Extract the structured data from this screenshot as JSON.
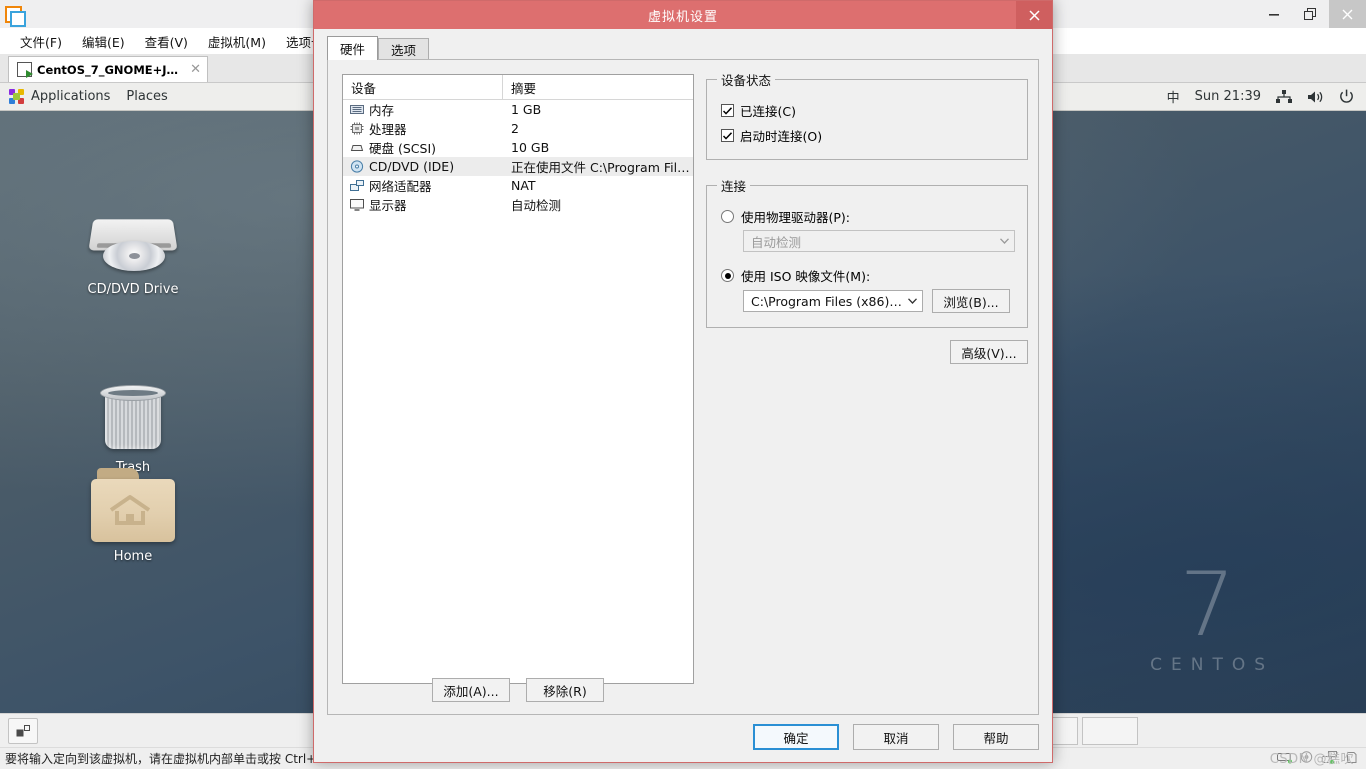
{
  "host": {
    "window_controls": {
      "minimize": "—",
      "restore": "❐",
      "close": "✕"
    },
    "menus": [
      "文件(F)",
      "编辑(E)",
      "查看(V)",
      "虚拟机(M)",
      "选项卡(T)"
    ],
    "tab": {
      "label": "CentOS_7_GNOME+Java+...",
      "close": "✕"
    },
    "statusbar": {
      "text": "要将输入定向到该虚拟机，请在虚拟机内部单击或按 Ctrl+"
    },
    "watermark": "CSDN @糕吹"
  },
  "guest": {
    "topbar": {
      "applications": "Applications",
      "places": "Places",
      "input_method": "中",
      "clock": "Sun 21:39"
    },
    "desktop_icons": [
      {
        "label": "CD/DVD Drive",
        "icon": "cd-drive-icon"
      },
      {
        "label": "Trash",
        "icon": "trash-icon"
      },
      {
        "label": "Home",
        "icon": "home-folder-icon"
      }
    ],
    "wallpaper_watermark": {
      "number": "7",
      "word": "CENTOS"
    }
  },
  "dialog": {
    "title": "虚拟机设置",
    "close_label": "✕",
    "tabs": [
      {
        "label": "硬件",
        "active": true
      },
      {
        "label": "选项",
        "active": false
      }
    ],
    "device_table": {
      "headers": [
        "设备",
        "摘要"
      ],
      "rows": [
        {
          "name": "内存",
          "summary": "1 GB",
          "icon": "memory-icon",
          "selected": false
        },
        {
          "name": "处理器",
          "summary": "2",
          "icon": "cpu-icon",
          "selected": false
        },
        {
          "name": "硬盘 (SCSI)",
          "summary": "10 GB",
          "icon": "harddisk-icon",
          "selected": false
        },
        {
          "name": "CD/DVD (IDE)",
          "summary": "正在使用文件 C:\\Program Files …",
          "icon": "cddvd-icon",
          "selected": true
        },
        {
          "name": "网络适配器",
          "summary": "NAT",
          "icon": "network-icon",
          "selected": false
        },
        {
          "name": "显示器",
          "summary": "自动检测",
          "icon": "display-icon",
          "selected": false
        }
      ]
    },
    "list_buttons": {
      "add": "添加(A)...",
      "remove": "移除(R)"
    },
    "device_status": {
      "legend": "设备状态",
      "connected": {
        "label": "已连接(C)",
        "checked": true
      },
      "connect_at_power_on": {
        "label": "启动时连接(O)",
        "checked": true
      }
    },
    "connection": {
      "legend": "连接",
      "physical_drive": {
        "label": "使用物理驱动器(P):",
        "selected": false,
        "value": "自动检测",
        "disabled": true
      },
      "iso_image": {
        "label": "使用 ISO 映像文件(M):",
        "selected": true,
        "value": "C:\\Program Files (x86)\\VMw"
      },
      "browse_button": "浏览(B)...",
      "advanced_button": "高级(V)..."
    },
    "footer_buttons": {
      "ok": "确定",
      "cancel": "取消",
      "help": "帮助"
    }
  },
  "colors": {
    "dialog_titlebar": "#dd6f6f",
    "dialog_close": "#cf5f5f",
    "focus_blue": "#2a8fd4",
    "selection_grey": "#ececec",
    "desktop_base": "#3d5368"
  }
}
